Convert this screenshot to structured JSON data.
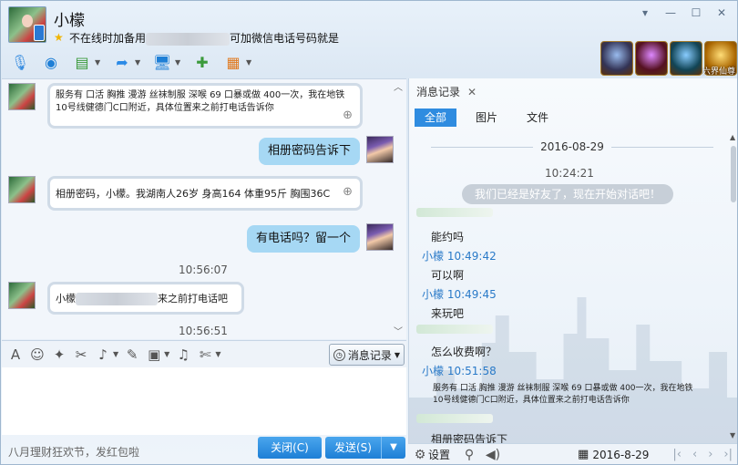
{
  "header": {
    "contact_name": "小檬",
    "status_prefix": "不在线时加备用",
    "status_suffix": "可加微信电话号码就是"
  },
  "window_controls": {
    "dropdown": "▾",
    "minimize": "—",
    "maximize": "☐",
    "close": "✕"
  },
  "toolbar": {
    "items": [
      "voice-call",
      "video-call",
      "share-screen",
      "send-file",
      "remote-desktop",
      "create-group",
      "apps"
    ]
  },
  "games": {
    "label": "六界仙尊"
  },
  "chat": {
    "messages": [
      {
        "dir": "in",
        "text": "服务有 口活 胸推 漫游 丝袜制服 深喉 69 口暴或做 400一次，我在地铁10号线健德门C口附近，具体位置来之前打电话告诉你"
      },
      {
        "dir": "out",
        "text": "相册密码告诉下"
      },
      {
        "dir": "in",
        "text": "相册密码，小檬。我湖南人26岁 身高164 体重95斤 胸围36C"
      },
      {
        "dir": "out",
        "text": "有电话吗？留一个"
      },
      {
        "dir": "time",
        "text": "10:56:07"
      },
      {
        "dir": "in",
        "text_prefix": "小檬",
        "text_suffix": "来之前打电话吧"
      },
      {
        "dir": "time",
        "text": "10:56:51"
      }
    ]
  },
  "input_toolbar": {
    "history_label": "消息记录"
  },
  "footer": {
    "promo": "八月理财狂欢节，发红包啦",
    "close_label": "关闭(C)",
    "send_label": "发送(S)"
  },
  "right_panel": {
    "tab_title": "消息记录",
    "filters": [
      "全部",
      "图片",
      "文件"
    ],
    "date": "2016-08-29",
    "time1": "10:24:21",
    "system_msg": "我们已经是好友了，现在开始对话吧！",
    "entries": [
      {
        "text": "能约吗"
      },
      {
        "sender": "小檬 10:49:42",
        "text": "可以啊"
      },
      {
        "sender": "小檬 10:49:45",
        "text": "来玩吧"
      },
      {
        "text": "怎么收费啊？"
      },
      {
        "sender": "小檬 10:51:58",
        "text": "服务有 口活 胸推 漫游 丝袜制服 深喉 69 口暴或做 400一次，我在地铁10号线健德门C口附近，具体位置来之前打电话告诉你"
      },
      {
        "text": "相册密码告诉下"
      }
    ],
    "footer_settings": "设置",
    "footer_date": "2016-8-29"
  },
  "colors": {
    "accent": "#2f8ce0",
    "bubble_out": "#a6d8f4",
    "sender": "#2a7ac8"
  }
}
